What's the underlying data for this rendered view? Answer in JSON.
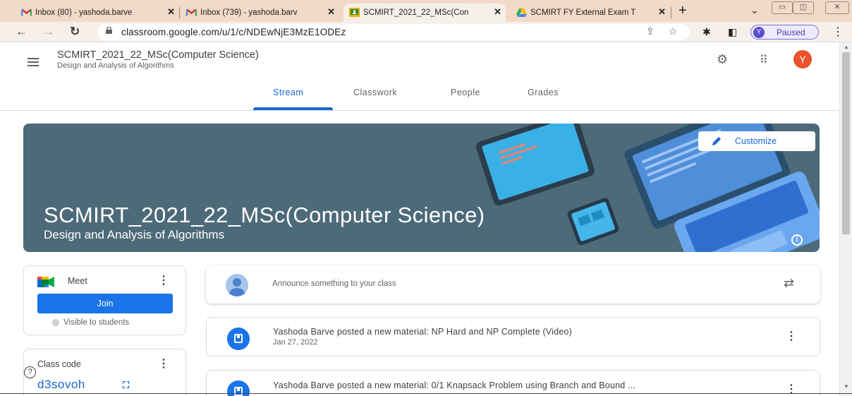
{
  "browser": {
    "tabs": [
      {
        "title": "Inbox (80) - yashoda.barve",
        "icon": "gmail-icon"
      },
      {
        "title": "Inbox (739) - yashoda.barv",
        "icon": "gmail-icon"
      },
      {
        "title": "SCMIRT_2021_22_MSc(Con",
        "icon": "classroom-icon"
      },
      {
        "title": "SCMIRT FY External Exam T",
        "icon": "drive-icon"
      }
    ],
    "url_host": "classroom.google.com",
    "url_path": "/u/1/c/NDEwNjE3MzE1ODEz",
    "profile_initial": "Y",
    "profile_status": "Paused"
  },
  "header": {
    "class_name": "SCMIRT_2021_22_MSc(Computer Science)",
    "subject": "Design and Analysis of Algorithms",
    "avatar_initial": "Y",
    "nav_tabs": [
      "Stream",
      "Classwork",
      "People",
      "Grades"
    ],
    "active_tab": "Stream"
  },
  "banner": {
    "title": "SCMIRT_2021_22_MSc(Computer Science)",
    "subtitle": "Design and Analysis of Algorithms",
    "customize_label": "Customize"
  },
  "meet": {
    "label": "Meet",
    "join_label": "Join",
    "visibility": "Visible to students"
  },
  "class_code": {
    "label": "Class code",
    "value": "d3sovoh"
  },
  "stream": {
    "announce_placeholder": "Announce something to your class",
    "posts": [
      {
        "title": "Yashoda Barve posted a new material: NP Hard and NP Complete (Video)",
        "date": "Jan 27, 2022"
      },
      {
        "title": "Yashoda Barve posted a new material: 0/1 Knapsack Problem using Branch and Bound ...",
        "date": ""
      }
    ]
  },
  "colors": {
    "accent": "#1967d2",
    "banner": "#4d6a79",
    "avatar": "#e8542c",
    "tab_strip": "#f3d9c7"
  }
}
